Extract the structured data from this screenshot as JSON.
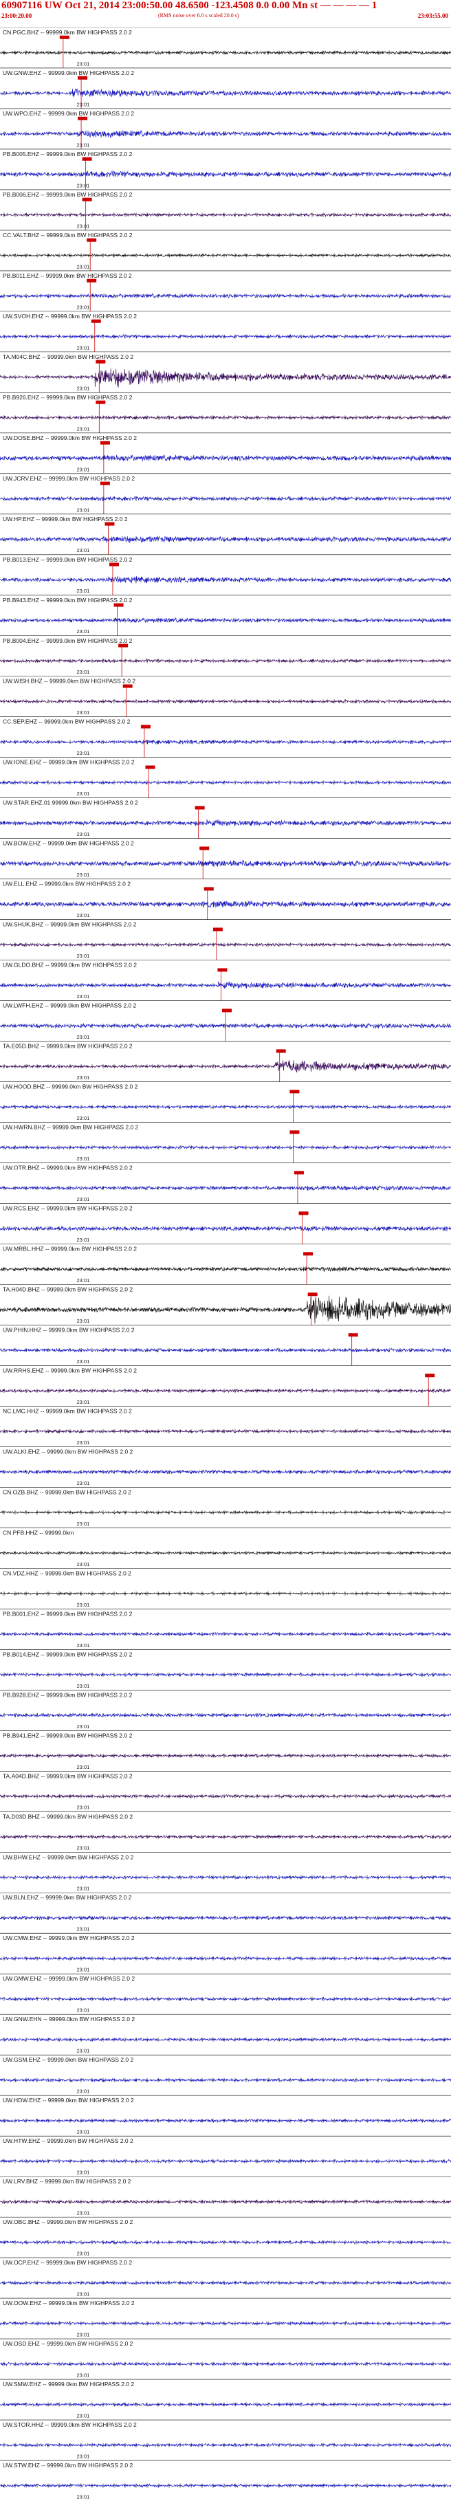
{
  "header": {
    "title": "60907116 UW Oct 21, 2014 23:00:50.00   48.6500  -123.4508   0.0  0.00  Mn st  — — — —  1",
    "start_time": "23:00:20.00",
    "note": "(RMS noise over 6.0 s scaled 20.0 s)",
    "end_time": "23:03:55.00"
  },
  "colors": {
    "blue": "#1c1ccc",
    "purple": "#3a0a5e",
    "black": "#111111",
    "pick": "#cc0000"
  },
  "tick_label": "23:01",
  "traces": [
    {
      "label": "CN.PGC.BHZ -- 99999.0km BW  HIGHPASS  2.0  2",
      "color": "black",
      "pick": 0.14,
      "amp": 0.5,
      "event_start": 0.1,
      "event_amp": 1.0
    },
    {
      "label": "UW.GNW.EHZ -- 99999.0km BW  HIGHPASS  2.0  2",
      "color": "blue",
      "pick": 0.18,
      "amp": 0.6,
      "event_start": 0.16,
      "event_amp": 2.5
    },
    {
      "label": "UW.WPO.EHZ -- 99999.0km BW  HIGHPASS  2.0  2",
      "color": "blue",
      "pick": 0.18,
      "amp": 0.6,
      "event_start": 0.17,
      "event_amp": 2.2
    },
    {
      "label": "PB.B005.EHZ -- 99999.0km BW  HIGHPASS  2.0  2",
      "color": "blue",
      "pick": 0.19,
      "amp": 0.7,
      "event_start": 0.18,
      "event_amp": 1.6
    },
    {
      "label": "PB.B006.EHZ -- 99999.0km BW  HIGHPASS  2.0  2",
      "color": "purple",
      "pick": 0.19,
      "amp": 0.5,
      "event_start": 0.18,
      "event_amp": 1.0
    },
    {
      "label": "CC.VALT.BHZ -- 99999.0km BW  HIGHPASS  2.0  2",
      "color": "black",
      "pick": 0.2,
      "amp": 0.4,
      "event_start": 0.19,
      "event_amp": 1.0
    },
    {
      "label": "PB.B011.EHZ -- 99999.0km BW  HIGHPASS  2.0  2",
      "color": "blue",
      "pick": 0.2,
      "amp": 0.6,
      "event_start": 0.19,
      "event_amp": 1.3
    },
    {
      "label": "UW.SVOH.EHZ -- 99999.0km BW  HIGHPASS  2.0  2",
      "color": "blue",
      "pick": 0.21,
      "amp": 0.5,
      "event_start": 0.2,
      "event_amp": 1.2
    },
    {
      "label": "TA.M04C.BHZ -- 99999.0km BW  HIGHPASS  2.0  2",
      "color": "purple",
      "pick": 0.22,
      "amp": 0.5,
      "event_start": 0.21,
      "event_amp": 7.0
    },
    {
      "label": "PB.B926.EHZ -- 99999.0km BW  HIGHPASS  2.0  2",
      "color": "purple",
      "pick": 0.22,
      "amp": 0.5,
      "event_start": 0.21,
      "event_amp": 1.2
    },
    {
      "label": "UW.DOSE.BHZ -- 99999.0km BW  HIGHPASS  2.0  2",
      "color": "blue",
      "pick": 0.23,
      "amp": 0.8,
      "event_start": 0.22,
      "event_amp": 1.5
    },
    {
      "label": "UW.JCRV.EHZ -- 99999.0km BW  HIGHPASS  2.0  2",
      "color": "blue",
      "pick": 0.23,
      "amp": 0.6,
      "event_start": 0.22,
      "event_amp": 1.2
    },
    {
      "label": "UW.HP.EHZ -- 99999.0km BW  HIGHPASS  2.0  2",
      "color": "blue",
      "pick": 0.24,
      "amp": 0.7,
      "event_start": 0.23,
      "event_amp": 1.8
    },
    {
      "label": "PB.B013.EHZ -- 99999.0km BW  HIGHPASS  2.0  2",
      "color": "blue",
      "pick": 0.25,
      "amp": 0.6,
      "event_start": 0.24,
      "event_amp": 2.0
    },
    {
      "label": "PB.B943.EHZ -- 99999.0km BW  HIGHPASS  2.0  2",
      "color": "blue",
      "pick": 0.26,
      "amp": 0.6,
      "event_start": 0.25,
      "event_amp": 1.5
    },
    {
      "label": "PB.B004.EHZ -- 99999.0km BW  HIGHPASS  2.0  2",
      "color": "purple",
      "pick": 0.27,
      "amp": 0.5,
      "event_start": 0.26,
      "event_amp": 1.0
    },
    {
      "label": "UW.WISH.BHZ -- 99999.0km BW  HIGHPASS  2.0  2",
      "color": "purple",
      "pick": 0.28,
      "amp": 0.5,
      "event_start": 0.27,
      "event_amp": 1.0
    },
    {
      "label": "CC.SEP.EHZ -- 99999.0km BW  HIGHPASS  2.0  2",
      "color": "blue",
      "pick": 0.32,
      "amp": 0.5,
      "event_start": 0.31,
      "event_amp": 1.5
    },
    {
      "label": "UW.IONE.EHZ -- 99999.0km BW  HIGHPASS  2.0  2",
      "color": "blue",
      "pick": 0.33,
      "amp": 0.5,
      "event_start": 0.32,
      "event_amp": 1.0
    },
    {
      "label": "UW.STAR.EHZ.01  99999.0km BW  HIGHPASS  2.0  2",
      "color": "blue",
      "pick": 0.44,
      "amp": 0.7,
      "event_start": 0.43,
      "event_amp": 1.6
    },
    {
      "label": "UW.BOW.EHZ -- 99999.0km BW  HIGHPASS  2.0  2",
      "color": "blue",
      "pick": 0.45,
      "amp": 0.8,
      "event_start": 0.44,
      "event_amp": 1.6
    },
    {
      "label": "UW.ELL.EHZ -- 99999.0km BW  HIGHPASS  2.0  2",
      "color": "blue",
      "pick": 0.46,
      "amp": 0.8,
      "event_start": 0.45,
      "event_amp": 1.5
    },
    {
      "label": "UW.SHUK.BHZ -- 99999.0km BW  HIGHPASS  2.0  2",
      "color": "purple",
      "pick": 0.48,
      "amp": 0.5,
      "event_start": 0.47,
      "event_amp": 1.1
    },
    {
      "label": "UW.GLDO.BHZ -- 99999.0km BW  HIGHPASS  2.0  2",
      "color": "blue",
      "pick": 0.49,
      "amp": 0.6,
      "event_start": 0.48,
      "event_amp": 2.0
    },
    {
      "label": "UW.LWFH.EHZ -- 99999.0km BW  HIGHPASS  2.0  2",
      "color": "blue",
      "pick": 0.5,
      "amp": 0.7,
      "event_start": 0.49,
      "event_amp": 1.2
    },
    {
      "label": "TA.E05D.BHZ -- 99999.0km BW  HIGHPASS  2.0  2",
      "color": "purple",
      "pick": 0.62,
      "amp": 0.5,
      "event_start": 0.61,
      "event_amp": 4.5
    },
    {
      "label": "UW.HOOD.BHZ -- 99999.0km BW  HIGHPASS  2.0  2",
      "color": "blue",
      "pick": 0.65,
      "amp": 0.5,
      "event_start": 0.64,
      "event_amp": 1.2
    },
    {
      "label": "UW.HWRN.BHZ -- 99999.0km BW  HIGHPASS  2.0  2",
      "color": "blue",
      "pick": 0.65,
      "amp": 0.5,
      "event_start": 0.64,
      "event_amp": 1.0
    },
    {
      "label": "UW.OTR.BHZ -- 99999.0km BW  HIGHPASS  2.0  2",
      "color": "blue",
      "pick": 0.66,
      "amp": 0.6,
      "event_start": 0.65,
      "event_amp": 1.5
    },
    {
      "label": "UW.RCS.EHZ -- 99999.0km BW  HIGHPASS  2.0  2",
      "color": "blue",
      "pick": 0.67,
      "amp": 0.7,
      "event_start": 0.66,
      "event_amp": 1.3
    },
    {
      "label": "UW.MRBL.HHZ -- 99999.0km BW  HIGHPASS  2.0  2",
      "color": "black",
      "pick": 0.68,
      "amp": 0.6,
      "event_start": 0.67,
      "event_amp": 1.5
    },
    {
      "label": "TA.H04D.BHZ -- 99999.0km BW  HIGHPASS  2.0  2",
      "color": "black",
      "pick": 0.69,
      "amp": 0.8,
      "event_start": 0.68,
      "event_amp": 6.0
    },
    {
      "label": "UW.PHIN.HHZ -- 99999.0km BW  HIGHPASS  2.0  2",
      "color": "blue",
      "pick": 0.78,
      "amp": 0.6,
      "event_start": 0.77,
      "event_amp": 1.0
    },
    {
      "label": "UW.RRHS.EHZ -- 99999.0km BW  HIGHPASS  2.0  2",
      "color": "purple",
      "pick": 0.95,
      "amp": 0.5,
      "event_start": 0.94,
      "event_amp": 1.2
    },
    {
      "label": "NC.LMC.HHZ -- 99999.0km BW  HIGHPASS  2.0  2",
      "color": "purple",
      "pick": null,
      "amp": 0.5,
      "event_start": 1.1,
      "event_amp": 1.0
    },
    {
      "label": "UW.ALKI.EHZ -- 99999.0km BW  HIGHPASS  2.0  2",
      "color": "blue",
      "pick": null,
      "amp": 0.6,
      "event_start": 1.1,
      "event_amp": 1.0
    },
    {
      "label": "CN.OZB.BHZ -- 99999.0km BW  HIGHPASS  2.0  2",
      "color": "black",
      "pick": null,
      "amp": 0.4,
      "event_start": 1.1,
      "event_amp": 1.0
    },
    {
      "label": "CN.PFB.HHZ -- 99999.0km",
      "color": "black",
      "pick": null,
      "amp": 0.35,
      "event_start": 1.1,
      "event_amp": 1.0
    },
    {
      "label": "CN.VDZ.HHZ -- 99999.0km BW  HIGHPASS  2.0  2",
      "color": "black",
      "pick": null,
      "amp": 0.35,
      "event_start": 1.1,
      "event_amp": 1.0
    },
    {
      "label": "PB.B001.EHZ -- 99999.0km BW  HIGHPASS  2.0  2",
      "color": "blue",
      "pick": null,
      "amp": 0.5,
      "event_start": 1.1,
      "event_amp": 1.0
    },
    {
      "label": "PB.B014.EHZ -- 99999.0km BW  HIGHPASS  2.0  2",
      "color": "blue",
      "pick": null,
      "amp": 0.5,
      "event_start": 1.1,
      "event_amp": 1.0
    },
    {
      "label": "PB.B928.EHZ -- 99999.0km BW  HIGHPASS  2.0  2",
      "color": "blue",
      "pick": null,
      "amp": 0.6,
      "event_start": 1.1,
      "event_amp": 1.0
    },
    {
      "label": "PB.B941.EHZ -- 99999.0km BW  HIGHPASS  2.0  2",
      "color": "purple",
      "pick": null,
      "amp": 0.5,
      "event_start": 1.1,
      "event_amp": 1.0
    },
    {
      "label": "TA.A04D.BHZ -- 99999.0km BW  HIGHPASS  2.0  2",
      "color": "purple",
      "pick": null,
      "amp": 0.5,
      "event_start": 1.1,
      "event_amp": 1.0
    },
    {
      "label": "TA.D03D.BHZ -- 99999.0km BW  HIGHPASS  2.0  2",
      "color": "purple",
      "pick": null,
      "amp": 0.5,
      "event_start": 1.1,
      "event_amp": 1.0
    },
    {
      "label": "UW.BHW.EHZ -- 99999.0km BW  HIGHPASS  2.0  2",
      "color": "blue",
      "pick": null,
      "amp": 0.5,
      "event_start": 1.1,
      "event_amp": 1.0
    },
    {
      "label": "UW.BLN.EHZ -- 99999.0km BW  HIGHPASS  2.0  2",
      "color": "blue",
      "pick": null,
      "amp": 0.6,
      "event_start": 1.1,
      "event_amp": 1.0
    },
    {
      "label": "UW.CMW.EHZ -- 99999.0km BW  HIGHPASS  2.0  2",
      "color": "blue",
      "pick": null,
      "amp": 0.5,
      "event_start": 1.1,
      "event_amp": 1.0
    },
    {
      "label": "UW.GMW.EHZ -- 99999.0km BW  HIGHPASS  2.0  2",
      "color": "blue",
      "pick": null,
      "amp": 0.5,
      "event_start": 1.1,
      "event_amp": 1.0
    },
    {
      "label": "UW.GNW.EHN -- 99999.0km BW  HIGHPASS  2.0  2",
      "color": "blue",
      "pick": null,
      "amp": 0.5,
      "event_start": 1.1,
      "event_amp": 1.0
    },
    {
      "label": "UW.GSM.EHZ -- 99999.0km BW  HIGHPASS  2.0  2",
      "color": "blue",
      "pick": null,
      "amp": 0.5,
      "event_start": 1.1,
      "event_amp": 1.0
    },
    {
      "label": "UW.HDW.EHZ -- 99999.0km BW  HIGHPASS  2.0  2",
      "color": "blue",
      "pick": null,
      "amp": 0.5,
      "event_start": 1.1,
      "event_amp": 1.0
    },
    {
      "label": "UW.HTW.EHZ -- 99999.0km BW  HIGHPASS  2.0  2",
      "color": "blue",
      "pick": null,
      "amp": 0.5,
      "event_start": 1.1,
      "event_amp": 1.0
    },
    {
      "label": "UW.LRV.BHZ -- 99999.0km BW  HIGHPASS  2.0  2",
      "color": "purple",
      "pick": null,
      "amp": 0.5,
      "event_start": 1.1,
      "event_amp": 1.0
    },
    {
      "label": "UW.OBC.BHZ -- 99999.0km BW  HIGHPASS  2.0  2",
      "color": "blue",
      "pick": null,
      "amp": 0.5,
      "event_start": 1.1,
      "event_amp": 1.0
    },
    {
      "label": "UW.OCP.EHZ -- 99999.0km BW  HIGHPASS  2.0  2",
      "color": "blue",
      "pick": null,
      "amp": 0.5,
      "event_start": 1.1,
      "event_amp": 1.0
    },
    {
      "label": "UW.OOW.EHZ -- 99999.0km BW  HIGHPASS  2.0  2",
      "color": "blue",
      "pick": null,
      "amp": 0.5,
      "event_start": 1.1,
      "event_amp": 1.0
    },
    {
      "label": "UW.OSD.EHZ -- 99999.0km BW  HIGHPASS  2.0  2",
      "color": "blue",
      "pick": null,
      "amp": 0.5,
      "event_start": 1.1,
      "event_amp": 1.0
    },
    {
      "label": "UW.SMW.EHZ -- 99999.0km BW  HIGHPASS  2.0  2",
      "color": "blue",
      "pick": null,
      "amp": 0.5,
      "event_start": 1.1,
      "event_amp": 1.0
    },
    {
      "label": "UW.STOR.HHZ -- 99999.0km BW  HIGHPASS  2.0  2",
      "color": "blue",
      "pick": null,
      "amp": 0.5,
      "event_start": 1.1,
      "event_amp": 1.0
    },
    {
      "label": "UW.STW.EHZ -- 99999.0km BW  HIGHPASS  2.0  2",
      "color": "blue",
      "pick": null,
      "amp": 0.5,
      "event_start": 1.1,
      "event_amp": 1.0
    }
  ]
}
